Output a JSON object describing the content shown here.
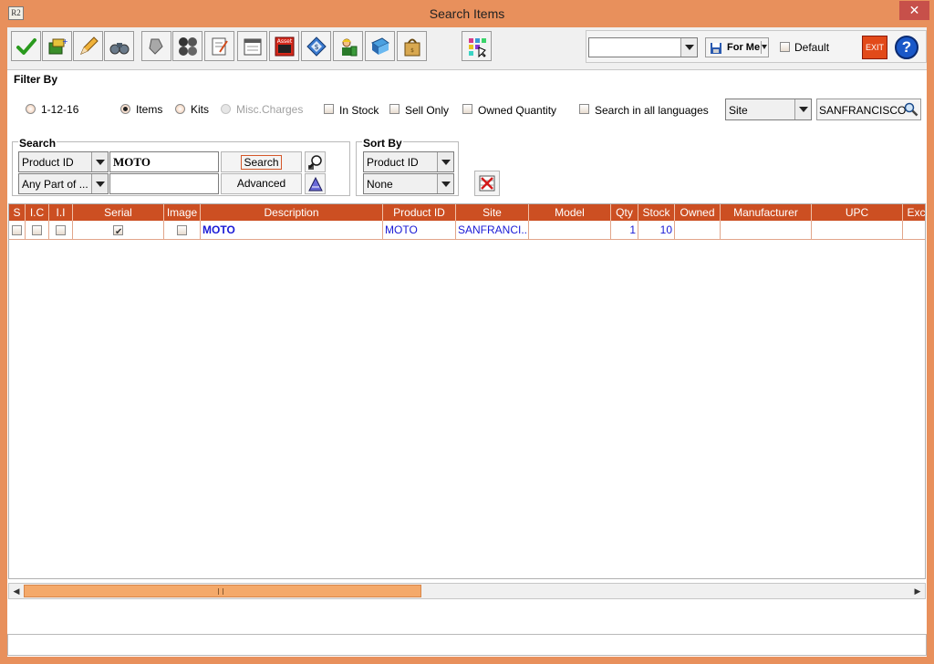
{
  "window": {
    "title": "Search Items",
    "app_icon": "R2",
    "close_label": "✕"
  },
  "toolbar": {
    "buttons": [
      "ok-check",
      "new-item",
      "edit-pencil",
      "binoculars",
      "shapes",
      "group",
      "notepad",
      "calendar",
      "asset",
      "money-tag",
      "worker",
      "book",
      "bag",
      "grid-select"
    ],
    "asset_label": "Asset",
    "view_value": "",
    "for_me_label": "For Me",
    "default_label": "Default",
    "exit_label": "EXIT",
    "help_label": "?"
  },
  "filter": {
    "title": "Filter By",
    "date_option": "1-12-16",
    "items_label": "Items",
    "kits_label": "Kits",
    "misc_label": "Misc.Charges",
    "in_stock_label": "In Stock",
    "sell_only_label": "Sell Only",
    "owned_qty_label": "Owned Quantity",
    "all_languages_label": "Search in all languages",
    "site_field": "Site",
    "site_value": "SANFRANCISCO"
  },
  "search": {
    "title": "Search",
    "field1": "Product ID",
    "value1": "MOTO",
    "match_mode": "Any Part of ...",
    "value2": "",
    "search_btn": "Search",
    "advanced_btn": "Advanced"
  },
  "sort": {
    "title": "Sort By",
    "sort1": "Product ID",
    "sort2": "None"
  },
  "grid": {
    "columns": [
      "S",
      "I.C",
      "I.I",
      "Serial",
      "Image",
      "Description",
      "Product ID",
      "Site",
      "Model",
      "Qty",
      "Stock",
      "Owned",
      "Manufacturer",
      "UPC",
      "Exc"
    ],
    "rows": [
      {
        "description": "MOTO",
        "product_id": "MOTO",
        "site": "SANFRANCI...",
        "model": "",
        "qty": "1",
        "stock": "10",
        "owned": "",
        "manufacturer": "",
        "upc": ""
      }
    ]
  },
  "colors": {
    "title_bar": "#e8905c",
    "grid_header": "#cc4f22",
    "link_text": "#1a1ad6"
  }
}
